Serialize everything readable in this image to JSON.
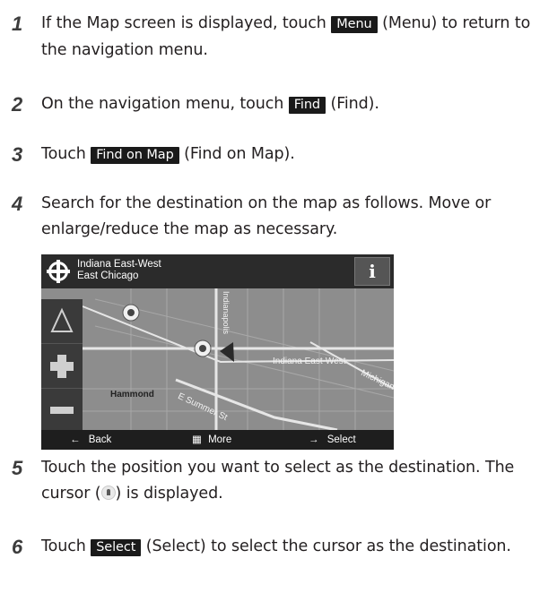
{
  "steps": [
    {
      "number": "1",
      "parts": [
        "If the Map screen is displayed, touch ",
        "Menu",
        " (Menu) to return to the navigation menu."
      ]
    },
    {
      "number": "2",
      "parts": [
        "On the navigation menu, touch ",
        "Find",
        " (Find)."
      ]
    },
    {
      "number": "3",
      "parts": [
        "Touch ",
        "Find on Map",
        " (Find on Map)."
      ]
    },
    {
      "number": "4",
      "parts": [
        "Search for the destination on the map as follows. Move or enlarge/reduce the map as necessary."
      ]
    },
    {
      "number": "5",
      "parts": [
        "Touch the position you want to select as the destination. The cursor (",
        ") is displayed."
      ]
    },
    {
      "number": "6",
      "parts": [
        "Touch ",
        "Select",
        " (Select) to select the cursor as the destination."
      ]
    }
  ],
  "map": {
    "address_line1": "Indiana East-West",
    "address_line2": "East Chicago",
    "info_label": "i",
    "road_labels": [
      "Indiana East-West",
      "Hammond",
      "E Summer St",
      "Michigan",
      "Indianapolis"
    ],
    "footer": {
      "back": "Back",
      "more": "More",
      "select": "Select"
    }
  },
  "colors": {
    "button_bg": "#1a1a1a",
    "button_fg": "#ffffff",
    "step_number": "#3c3c3c"
  }
}
